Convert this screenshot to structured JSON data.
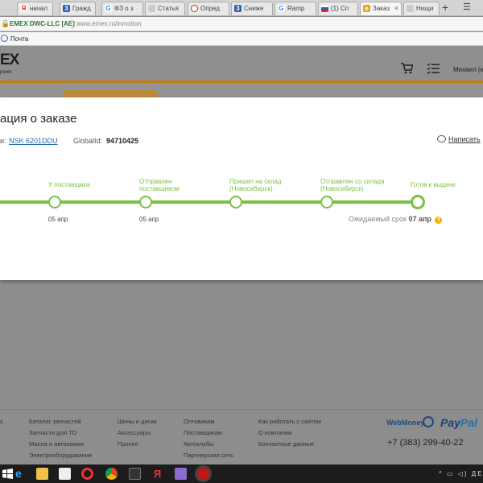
{
  "browser": {
    "tabs": [
      {
        "label": "начал",
        "icon": "yandex-icon"
      },
      {
        "label": "Гражд",
        "icon": "three-icon"
      },
      {
        "label": "ФЗ о з",
        "icon": "google-icon"
      },
      {
        "label": "Статья",
        "icon": "doc-icon"
      },
      {
        "label": "Опред",
        "icon": "opera-icon"
      },
      {
        "label": "Сниже",
        "icon": "three-icon"
      },
      {
        "label": "Ramp",
        "icon": "google-icon"
      },
      {
        "label": "(1) Сп",
        "icon": "flag-icon"
      },
      {
        "label": "Заказ",
        "icon": "emex-icon"
      },
      {
        "label": "Нищи",
        "icon": "doc-icon"
      }
    ],
    "new_tab": "+",
    "menu": "☰",
    "cert": "EMEX DWC-LLC [AE]",
    "url": "www.emex.ru/inmotion",
    "bookmark": "Почта"
  },
  "header": {
    "logo": "EX",
    "logo_sub": "ремя",
    "user": "Михаил (ю"
  },
  "modal": {
    "title": "ация о заказе",
    "order_label": "и:",
    "order_number": "NSK 6201DDU",
    "globalid_label": "GlobalId:",
    "globalid_value": "94710425",
    "write_link": "Написать",
    "steps": [
      {
        "label_line1": "У поставщика",
        "label_line2": "",
        "date": "05 апр"
      },
      {
        "label_line1": "Отправлен",
        "label_line2": "поставщиком",
        "date": "05 апр"
      },
      {
        "label_line1": "Пришел на склад",
        "label_line2": "(Новосибирск)",
        "date": ""
      },
      {
        "label_line1": "Отправлен со склада",
        "label_line2": "(Новосибирск)",
        "date": ""
      },
      {
        "label_line1": "Готов к выдаче",
        "label_line2": "",
        "date": ""
      }
    ],
    "expected_label": "Ожидаемый срок",
    "expected_date": "07 апр",
    "help": "?"
  },
  "footer": {
    "col0": [
      "s",
      "",
      "",
      ""
    ],
    "col1": [
      "Каталог запчастей",
      "Запчасти для ТО",
      "Масла и автохимия",
      "Электрооборудование"
    ],
    "col2": [
      "Шины и диски",
      "Аксессуары",
      "Прочее"
    ],
    "col3": [
      "Оптовикам",
      "Поставщикам",
      "Автоклубы",
      "Партнерская сеть"
    ],
    "col4": [
      "Как работать с сайтом",
      "О компании",
      "Контактные данные"
    ],
    "webmoney": "WebMoney",
    "paypal_a": "Pay",
    "paypal_b": "Pal",
    "phone": "+7 (383) 299-40-22"
  },
  "taskbar": {
    "tray": "^ ▭ ◁) ДЕ"
  },
  "colors": {
    "accent_green": "#7bc043",
    "brand_orange": "#c47f12",
    "link_blue": "#2a6bb0"
  }
}
